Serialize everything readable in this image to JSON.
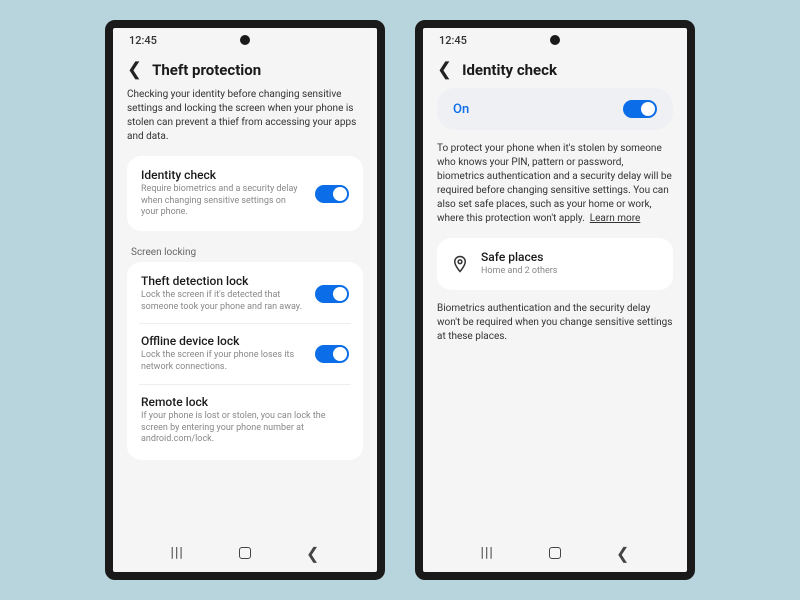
{
  "status_time": "12:45",
  "left": {
    "title": "Theft protection",
    "description": "Checking your identity before changing sensitive settings and locking the screen when your phone is stolen can prevent a thief from accessing your apps and data.",
    "identity_check": {
      "title": "Identity check",
      "sub": "Require biometrics and a security delay when changing sensitive settings on your phone."
    },
    "section_label": "Screen locking",
    "theft_detection": {
      "title": "Theft detection lock",
      "sub": "Lock the screen if it's detected that someone took your phone and ran away."
    },
    "offline_lock": {
      "title": "Offline device lock",
      "sub": "Lock the screen if your phone loses its network connections."
    },
    "remote_lock": {
      "title": "Remote lock",
      "sub": "If your phone is lost or stolen, you can lock the screen by entering your phone number at android.com/lock."
    }
  },
  "right": {
    "title": "Identity check",
    "on_label": "On",
    "description": "To protect your phone when it's stolen by someone who knows your PIN, pattern or password, biometrics authentication and a security delay will be required before changing sensitive settings. You can also set safe places, such as your home or work, where this protection won't apply.",
    "learn_more": "Learn more",
    "safe_places": {
      "title": "Safe places",
      "sub": "Home and 2 others"
    },
    "footer": "Biometrics authentication and the security delay won't be required when you change sensitive settings at these places."
  }
}
